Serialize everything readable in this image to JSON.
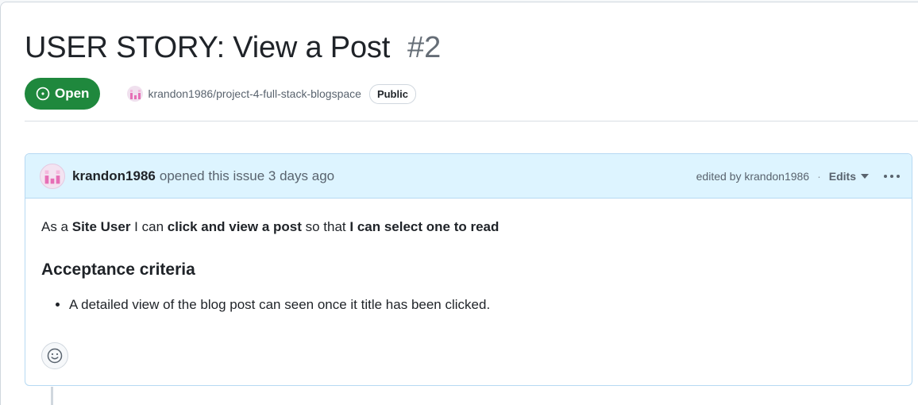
{
  "issue": {
    "title": "USER STORY: View a Post",
    "number": "#2",
    "state": "Open",
    "repo": "krandon1986/project-4-full-stack-blogspace",
    "visibility": "Public"
  },
  "comment": {
    "author": "krandon1986",
    "opened_text": "opened this issue 3 days ago",
    "edited_by": "edited by krandon1986",
    "separator": "·",
    "edits_label": "Edits",
    "story": {
      "p1": "As a ",
      "b1": "Site User",
      "p2": " I can ",
      "b2": "click and view a post",
      "p3": " so that ",
      "b3": "I can select one to read"
    },
    "criteria_heading": "Acceptance criteria",
    "criteria_items": [
      "A detailed view of the blog post can seen once it title has been clicked."
    ]
  },
  "colors": {
    "open_green": "#1f883d",
    "header_blue": "#ddf4ff",
    "border_blue": "#b6d9f3"
  },
  "icons": {
    "state": "issue-opened-icon",
    "reaction": "smiley-icon",
    "menu": "kebab-horizontal-icon",
    "caret": "triangle-down-icon"
  }
}
